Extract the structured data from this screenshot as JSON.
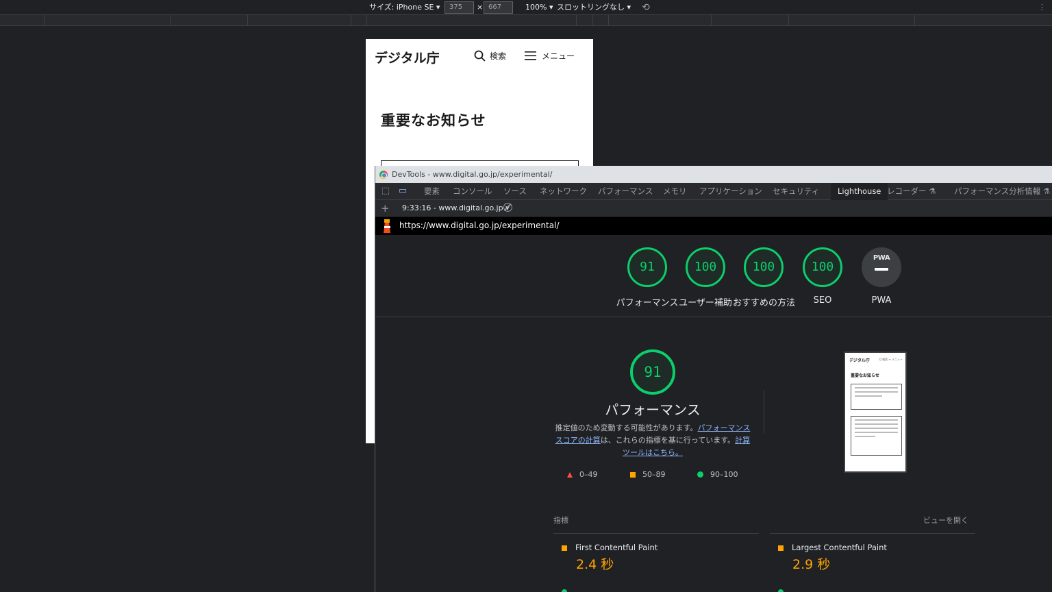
{
  "device_toolbar": {
    "size_label": "サイズ: iPhone SE ▾",
    "width": "375",
    "times": "×",
    "height": "667",
    "zoom": "100% ▾",
    "throttle": "スロットリングなし ▾",
    "more": "⋮"
  },
  "site": {
    "logo": "デジタル庁",
    "search": "検索",
    "menu": "メニュー",
    "heading": "重要なお知らせ"
  },
  "devtools": {
    "window_title": "DevTools - www.digital.go.jp/experimental/",
    "tabs": [
      "要素",
      "コンソール",
      "ソース",
      "ネットワーク",
      "パフォーマンス",
      "メモリ",
      "アプリケーション",
      "セキュリティ",
      "Lighthouse",
      "レコーダー ⚗",
      "パフォーマンス分析情報 ⚗"
    ],
    "active_tab": "Lighthouse",
    "report_selector": "9:33:16 - www.digital.go.jp ▾",
    "url": "https://www.digital.go.jp/experimental/"
  },
  "lighthouse": {
    "gauges": [
      {
        "score": "91",
        "label": "パフォーマンス"
      },
      {
        "score": "100",
        "label": "ユーザー補助"
      },
      {
        "score": "100",
        "label": "おすすめの方法"
      },
      {
        "score": "100",
        "label": "SEO"
      }
    ],
    "pwa": {
      "badge": "PWA",
      "label": "PWA"
    },
    "main_score": "91",
    "main_title": "パフォーマンス",
    "desc_pre": "推定値のため変動する可能性があります。",
    "desc_link1": "パフォーマンス スコアの計算",
    "desc_mid": "は、これらの指標を基に行っています。",
    "desc_link2": "計算ツールはこちら。",
    "legend": {
      "red": "0–49",
      "orange": "50–89",
      "green": "90–100"
    },
    "thumbnail": {
      "logo": "デジタル庁",
      "nav": "Q 検索  ≡ メニュー",
      "title": "重要なお知らせ"
    },
    "metrics_label": "指標",
    "view_label": "ビューを開く",
    "metrics": [
      {
        "name": "First Contentful Paint",
        "value": "2.4 秒"
      },
      {
        "name": "Largest Contentful Paint",
        "value": "2.9 秒"
      }
    ]
  },
  "colors": {
    "pass": "#0cce6b",
    "average": "#ffa400",
    "fail": "#ff4e42",
    "link": "#8ab4f8"
  }
}
